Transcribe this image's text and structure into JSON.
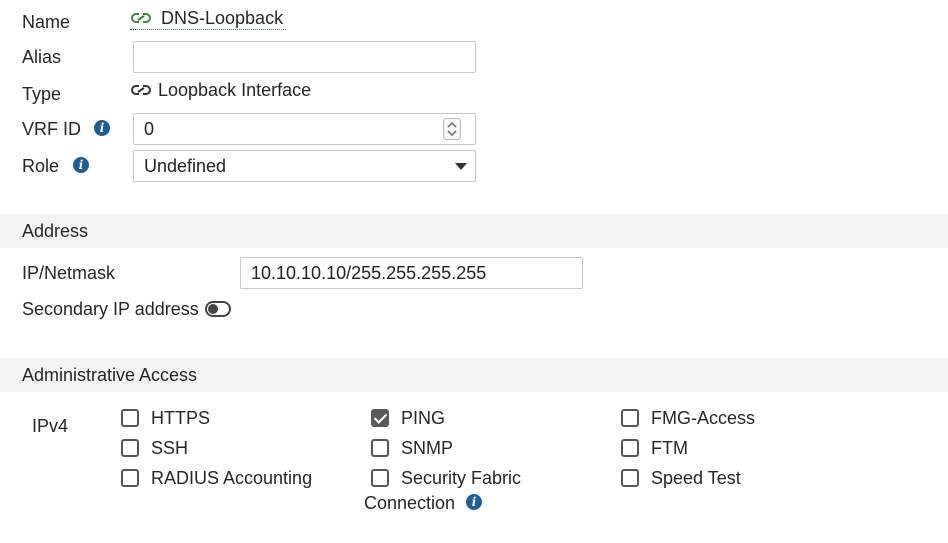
{
  "form": {
    "name_label": "Name",
    "name_value": "DNS-Loopback",
    "alias_label": "Alias",
    "alias_value": "",
    "type_label": "Type",
    "type_value": "Loopback Interface",
    "vrf_label": "VRF ID",
    "vrf_value": "0",
    "role_label": "Role",
    "role_value": "Undefined"
  },
  "address": {
    "section_title": "Address",
    "ip_label": "IP/Netmask",
    "ip_value": "10.10.10.10/255.255.255.255",
    "secondary_label": "Secondary IP address",
    "secondary_enabled": false
  },
  "admin_access": {
    "section_title": "Administrative Access",
    "ipv4_label": "IPv4",
    "options": [
      {
        "label": "HTTPS",
        "checked": false
      },
      {
        "label": "PING",
        "checked": true
      },
      {
        "label": "FMG-Access",
        "checked": false
      },
      {
        "label": "SSH",
        "checked": false
      },
      {
        "label": "SNMP",
        "checked": false
      },
      {
        "label": "FTM",
        "checked": false
      },
      {
        "label": "RADIUS Accounting",
        "checked": false
      },
      {
        "label": "Security Fabric",
        "label_cont": "Connection",
        "checked": false
      },
      {
        "label": "Speed Test",
        "checked": false
      }
    ]
  },
  "icons": {
    "name_icon": "link-icon",
    "type_icon": "link-icon",
    "info_icon": "info-icon",
    "info_glyph": "i"
  },
  "colors": {
    "name_icon_color": "#3a8a3a",
    "info_color": "#1f5f95",
    "section_bg": "#f3f3f3"
  }
}
